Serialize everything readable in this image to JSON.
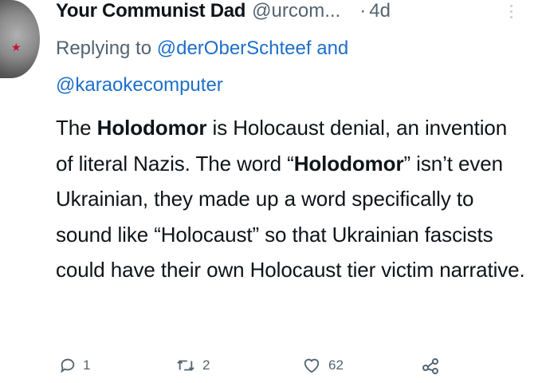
{
  "tweet": {
    "display_name": "Your Communist Dad",
    "handle": "@urcom...",
    "dot": "·",
    "time": "4d",
    "replying_prefix": "Replying to",
    "mention_1": "@derOberSchteef",
    "replying_and": "and",
    "mention_2": "@karaokecomputer",
    "body_parts": [
      {
        "text": "The ",
        "bold": false
      },
      {
        "text": "Holodomor",
        "bold": true
      },
      {
        "text": " is Holocaust denial, an invention of literal Nazis. The word “",
        "bold": false
      },
      {
        "text": "Holodomor",
        "bold": true
      },
      {
        "text": "” isn’t even Ukrainian, they made up a word specifically to sound like “Holocaust” so that Ukrainian fascists could have their own Holocaust tier victim narrative.",
        "bold": false
      }
    ],
    "replies": "1",
    "retweets": "2",
    "likes": "62"
  },
  "icons": {
    "reply": "reply-bubble-icon",
    "retweet": "retweet-icon",
    "like": "heart-icon",
    "share": "share-icon",
    "more": "more-dots-icon"
  },
  "colors": {
    "text": "#0f1419",
    "secondary": "#536471",
    "link": "#1d6fc9"
  }
}
